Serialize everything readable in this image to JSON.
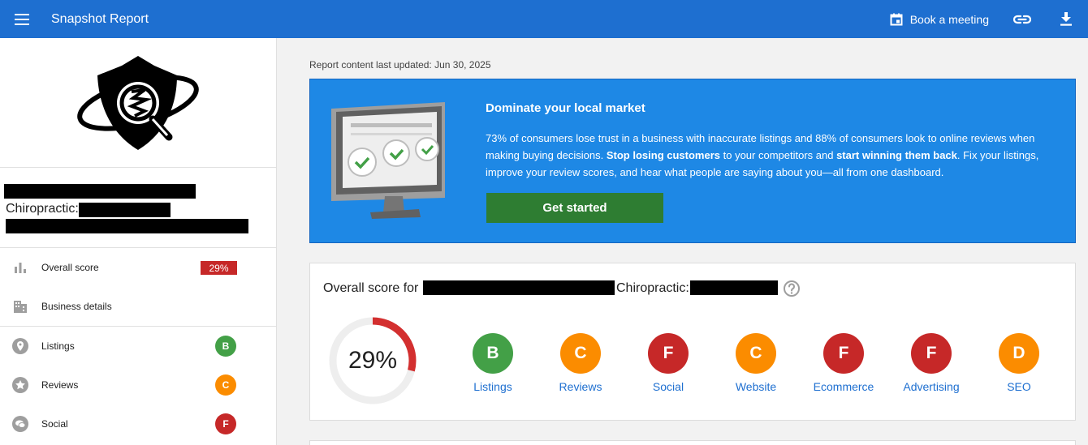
{
  "header": {
    "title": "Snapshot Report",
    "book_label": "Book a meeting",
    "icons": [
      "menu-icon",
      "calendar-icon",
      "link-icon",
      "download-icon"
    ]
  },
  "sidebar": {
    "category_label": "Chiropractic:",
    "nav": [
      {
        "label": "Overall score",
        "icon": "bar-chart-icon",
        "badge": "29%",
        "badge_color": "#c62828"
      },
      {
        "label": "Business details",
        "icon": "building-icon"
      },
      {
        "label": "Listings",
        "icon": "location-pin-icon",
        "grade": "B",
        "grade_color": "#43a047"
      },
      {
        "label": "Reviews",
        "icon": "star-icon",
        "grade": "C",
        "grade_color": "#fb8c00"
      },
      {
        "label": "Social",
        "icon": "chat-bubble-icon",
        "grade": "F",
        "grade_color": "#c62828"
      }
    ]
  },
  "main": {
    "last_updated": "Report content last updated:  Jun 30, 2025",
    "promo": {
      "title": "Dominate your local market",
      "text_1": "73% of consumers lose trust in a business with inaccurate listings and 88% of consumers look to online reviews when making buying decisions. ",
      "bold_1": "Stop losing customers",
      "text_2": " to your competitors and ",
      "bold_2": "start winning them back",
      "text_3": ". Fix your listings, improve your review scores, and hear what people are saying about you—all from one dashboard.",
      "button": "Get started"
    },
    "score": {
      "title_prefix": "Overall score for",
      "category": "Chiropractic:",
      "percent_label": "29%",
      "percent_value": 29,
      "ring_color": "#d32f2f",
      "track_color": "#eeeeee",
      "grades": [
        {
          "label": "Listings",
          "grade": "B",
          "color": "#43a047"
        },
        {
          "label": "Reviews",
          "grade": "C",
          "color": "#fb8c00"
        },
        {
          "label": "Social",
          "grade": "F",
          "color": "#c62828"
        },
        {
          "label": "Website",
          "grade": "C",
          "color": "#fb8c00"
        },
        {
          "label": "Ecommerce",
          "grade": "F",
          "color": "#c62828"
        },
        {
          "label": "Advertising",
          "grade": "F",
          "color": "#c62828"
        },
        {
          "label": "SEO",
          "grade": "D",
          "color": "#fb8c00"
        }
      ]
    }
  }
}
